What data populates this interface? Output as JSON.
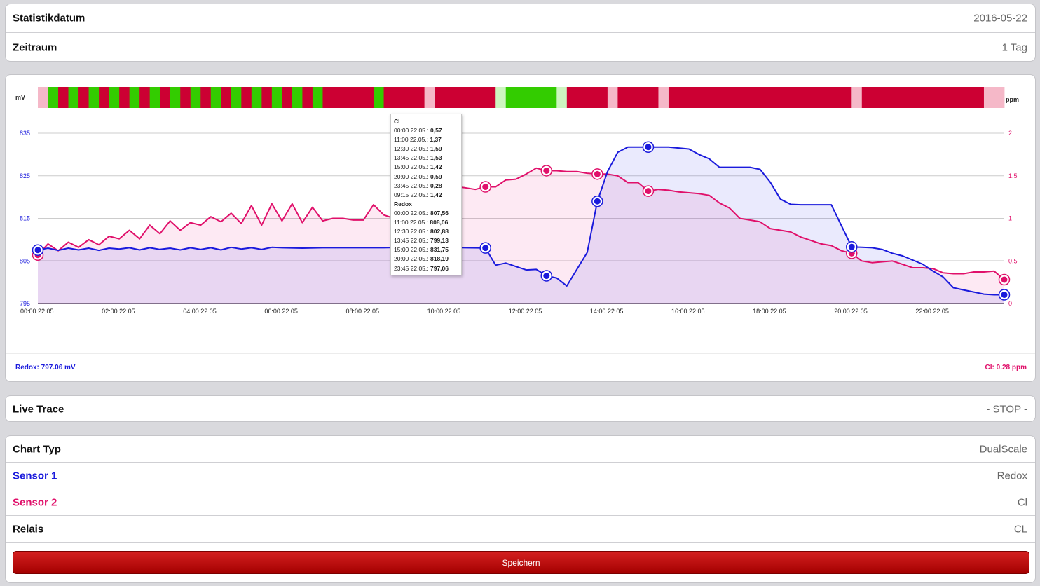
{
  "settings": {
    "date_label": "Statistikdatum",
    "date_value": "2016-05-22",
    "period_label": "Zeitraum",
    "period_value": "1 Tag"
  },
  "live": {
    "label": "Live Trace",
    "value": "- STOP -"
  },
  "config": {
    "chart_type_label": "Chart Typ",
    "chart_type_value": "DualScale",
    "sensor1_label": "Sensor 1",
    "sensor1_value": "Redox",
    "sensor2_label": "Sensor 2",
    "sensor2_value": "Cl",
    "relay_label": "Relais",
    "relay_value": "CL",
    "save_label": "Speichern"
  },
  "legend": {
    "left": "Redox: 797.06 mV",
    "right": "Cl: 0.28 ppm"
  },
  "tooltip": {
    "cl_title": "Cl",
    "cl_rows": [
      {
        "t": "00:00 22.05.:",
        "v": "0,57"
      },
      {
        "t": "11:00 22.05.:",
        "v": "1,37"
      },
      {
        "t": "12:30 22.05.:",
        "v": "1,59"
      },
      {
        "t": "13:45 22.05.:",
        "v": "1,53"
      },
      {
        "t": "15:00 22.05.:",
        "v": "1,42"
      },
      {
        "t": "20:00 22.05.:",
        "v": "0,59"
      },
      {
        "t": "23:45 22.05.:",
        "v": "0,28"
      },
      {
        "t": "09:15 22.05.:",
        "v": "1,42"
      }
    ],
    "redox_title": "Redox",
    "redox_rows": [
      {
        "t": "00:00 22.05.:",
        "v": "807,56"
      },
      {
        "t": "11:00 22.05.:",
        "v": "808,06"
      },
      {
        "t": "12:30 22.05.:",
        "v": "802,88"
      },
      {
        "t": "13:45 22.05.:",
        "v": "799,13"
      },
      {
        "t": "15:00 22.05.:",
        "v": "831,75"
      },
      {
        "t": "20:00 22.05.:",
        "v": "818,19"
      },
      {
        "t": "23:45 22.05.:",
        "v": "797,06"
      }
    ]
  },
  "colors": {
    "redox": "#1a1adc",
    "cl": "#e0106a",
    "relay_on": "#33cc00",
    "relay_off": "#cc0033",
    "relay_on_light": "#cdf5c0",
    "relay_off_light": "#f5b8c8",
    "redox_fill": "rgba(60,60,240,0.11)",
    "cl_fill": "rgba(235,40,140,0.10)"
  },
  "chart_data": {
    "type": "line",
    "x_unit": "hours (00:00 22.05. to 23:45 22.05.)",
    "x_tick_labels": [
      "00:00 22.05.",
      "02:00 22.05.",
      "04:00 22.05.",
      "06:00 22.05.",
      "08:00 22.05.",
      "10:00 22.05.",
      "12:00 22.05.",
      "14:00 22.05.",
      "16:00 22.05.",
      "18:00 22.05.",
      "20:00 22.05.",
      "22:00 22.05."
    ],
    "y_left": {
      "label": "mV",
      "ticks": [
        795,
        805,
        815,
        825,
        835
      ],
      "range": [
        795,
        835
      ]
    },
    "y_right": {
      "label": "ppm",
      "ticks": [
        "0",
        "0,5",
        "1",
        "1,5",
        "2"
      ],
      "range": [
        0,
        2
      ]
    },
    "series": [
      {
        "name": "Redox",
        "axis": "left",
        "x": [
          0,
          0.25,
          0.5,
          0.75,
          1,
          1.25,
          1.5,
          1.75,
          2,
          2.25,
          2.5,
          2.75,
          3,
          3.25,
          3.5,
          3.75,
          4,
          4.25,
          4.5,
          4.75,
          5,
          5.25,
          5.5,
          5.75,
          6,
          6.5,
          7,
          7.5,
          8,
          8.5,
          9,
          9.5,
          10,
          10.5,
          11,
          11.25,
          11.5,
          12,
          12.25,
          12.5,
          12.75,
          13,
          13.5,
          13.75,
          14,
          14.25,
          14.5,
          14.75,
          15,
          15.5,
          16,
          16.25,
          16.5,
          16.75,
          17,
          17.5,
          17.75,
          18,
          18.25,
          18.5,
          18.75,
          19,
          19.5,
          20,
          20.25,
          20.5,
          20.75,
          21,
          21.25,
          21.5,
          21.75,
          22,
          22.25,
          22.5,
          22.75,
          23,
          23.25,
          23.5,
          23.75
        ],
        "y": [
          807.56,
          808.0,
          807.5,
          808.0,
          807.6,
          808.0,
          807.5,
          808.0,
          807.8,
          808.1,
          807.6,
          808.1,
          807.7,
          808.0,
          807.6,
          808.1,
          807.7,
          808.1,
          807.6,
          808.2,
          807.8,
          808.1,
          807.7,
          808.2,
          808.1,
          808.0,
          808.1,
          808.1,
          808.1,
          808.1,
          808.2,
          808.1,
          808.2,
          808.1,
          808.06,
          804.0,
          804.5,
          802.88,
          803.0,
          801.5,
          801.0,
          799.13,
          807.0,
          819.0,
          826.0,
          830.5,
          831.75,
          831.75,
          831.75,
          831.75,
          831.3,
          830.0,
          829.0,
          827.0,
          827.0,
          827.0,
          826.5,
          823.5,
          819.5,
          818.3,
          818.19,
          818.19,
          818.19,
          808.3,
          808.2,
          808.1,
          807.7,
          806.8,
          806.2,
          805.2,
          804.2,
          802.6,
          801.2,
          798.7,
          798.2,
          797.7,
          797.2,
          797.06,
          797.06
        ],
        "markers_x": [
          0,
          11,
          12.5,
          13.75,
          15,
          20,
          23.75
        ]
      },
      {
        "name": "Cl",
        "axis": "right",
        "x": [
          0,
          0.25,
          0.5,
          0.75,
          1,
          1.25,
          1.5,
          1.75,
          2,
          2.25,
          2.5,
          2.75,
          3,
          3.25,
          3.5,
          3.75,
          4,
          4.25,
          4.5,
          4.75,
          5,
          5.25,
          5.5,
          5.75,
          6,
          6.25,
          6.5,
          6.75,
          7,
          7.25,
          7.5,
          7.75,
          8,
          8.25,
          8.5,
          8.75,
          9,
          9.25,
          9.5,
          9.75,
          10,
          10.25,
          10.5,
          10.75,
          11,
          11.25,
          11.5,
          11.75,
          12,
          12.25,
          12.5,
          12.75,
          13,
          13.25,
          13.5,
          13.75,
          14,
          14.25,
          14.5,
          14.75,
          15,
          15.25,
          15.5,
          15.75,
          16,
          16.25,
          16.5,
          16.75,
          17,
          17.25,
          17.5,
          17.75,
          18,
          18.25,
          18.5,
          18.75,
          19,
          19.25,
          19.5,
          19.75,
          20,
          20.25,
          20.5,
          20.75,
          21,
          21.25,
          21.5,
          21.75,
          22,
          22.25,
          22.5,
          22.75,
          23,
          23.25,
          23.5,
          23.75
        ],
        "y": [
          0.57,
          0.7,
          0.62,
          0.72,
          0.66,
          0.75,
          0.69,
          0.79,
          0.76,
          0.86,
          0.76,
          0.92,
          0.82,
          0.97,
          0.86,
          0.95,
          0.92,
          1.02,
          0.96,
          1.06,
          0.94,
          1.15,
          0.92,
          1.17,
          0.97,
          1.17,
          0.95,
          1.13,
          0.97,
          1.0,
          1.0,
          0.98,
          0.98,
          1.16,
          1.04,
          1.0,
          1.05,
          1.1,
          1.1,
          1.2,
          1.35,
          1.37,
          1.36,
          1.34,
          1.37,
          1.37,
          1.45,
          1.46,
          1.52,
          1.59,
          1.56,
          1.56,
          1.55,
          1.55,
          1.53,
          1.52,
          1.52,
          1.5,
          1.42,
          1.42,
          1.32,
          1.34,
          1.33,
          1.31,
          1.3,
          1.29,
          1.27,
          1.18,
          1.12,
          1.0,
          0.98,
          0.96,
          0.88,
          0.86,
          0.84,
          0.78,
          0.74,
          0.7,
          0.68,
          0.62,
          0.59,
          0.5,
          0.48,
          0.49,
          0.5,
          0.46,
          0.42,
          0.42,
          0.41,
          0.36,
          0.35,
          0.35,
          0.37,
          0.37,
          0.38,
          0.28
        ],
        "markers_x": [
          0,
          11,
          12.5,
          13.75,
          15,
          20,
          23.75
        ]
      }
    ],
    "relay_blocks": [
      [
        "off_light",
        0,
        0.25
      ],
      [
        "on",
        0.25,
        0.5
      ],
      [
        "off",
        0.5,
        0.75
      ],
      [
        "on",
        0.75,
        1
      ],
      [
        "off",
        1,
        1.25
      ],
      [
        "on",
        1.25,
        1.5
      ],
      [
        "off",
        1.5,
        1.75
      ],
      [
        "on",
        1.75,
        2
      ],
      [
        "off",
        2,
        2.25
      ],
      [
        "on",
        2.25,
        2.5
      ],
      [
        "off",
        2.5,
        2.75
      ],
      [
        "on",
        2.75,
        3
      ],
      [
        "off",
        3,
        3.25
      ],
      [
        "on",
        3.25,
        3.5
      ],
      [
        "off",
        3.5,
        3.75
      ],
      [
        "on",
        3.75,
        4
      ],
      [
        "off",
        4,
        4.25
      ],
      [
        "on",
        4.25,
        4.5
      ],
      [
        "off",
        4.5,
        4.75
      ],
      [
        "on",
        4.75,
        5
      ],
      [
        "off",
        5,
        5.25
      ],
      [
        "on",
        5.25,
        5.5
      ],
      [
        "off",
        5.5,
        5.75
      ],
      [
        "on",
        5.75,
        6
      ],
      [
        "off",
        6,
        6.25
      ],
      [
        "on",
        6.25,
        6.5
      ],
      [
        "off",
        6.5,
        6.75
      ],
      [
        "on",
        6.75,
        7
      ],
      [
        "off",
        7,
        7.5
      ],
      [
        "off",
        7.5,
        8
      ],
      [
        "off",
        8,
        8.25
      ],
      [
        "on",
        8.25,
        8.5
      ],
      [
        "off",
        8.5,
        9.25
      ],
      [
        "off",
        9.25,
        9.5
      ],
      [
        "off_light",
        9.5,
        9.75
      ],
      [
        "off",
        9.75,
        11.25
      ],
      [
        "on_light",
        11.25,
        11.5
      ],
      [
        "on",
        11.5,
        12.75
      ],
      [
        "on_light",
        12.75,
        13
      ],
      [
        "off",
        13,
        14
      ],
      [
        "off_light",
        14,
        14.25
      ],
      [
        "off",
        14.25,
        15.25
      ],
      [
        "off_light",
        15.25,
        15.5
      ],
      [
        "off",
        15.5,
        20
      ],
      [
        "off_light",
        20,
        20.25
      ],
      [
        "off",
        20.25,
        23.25
      ],
      [
        "off_light",
        23.25,
        23.75
      ]
    ]
  }
}
